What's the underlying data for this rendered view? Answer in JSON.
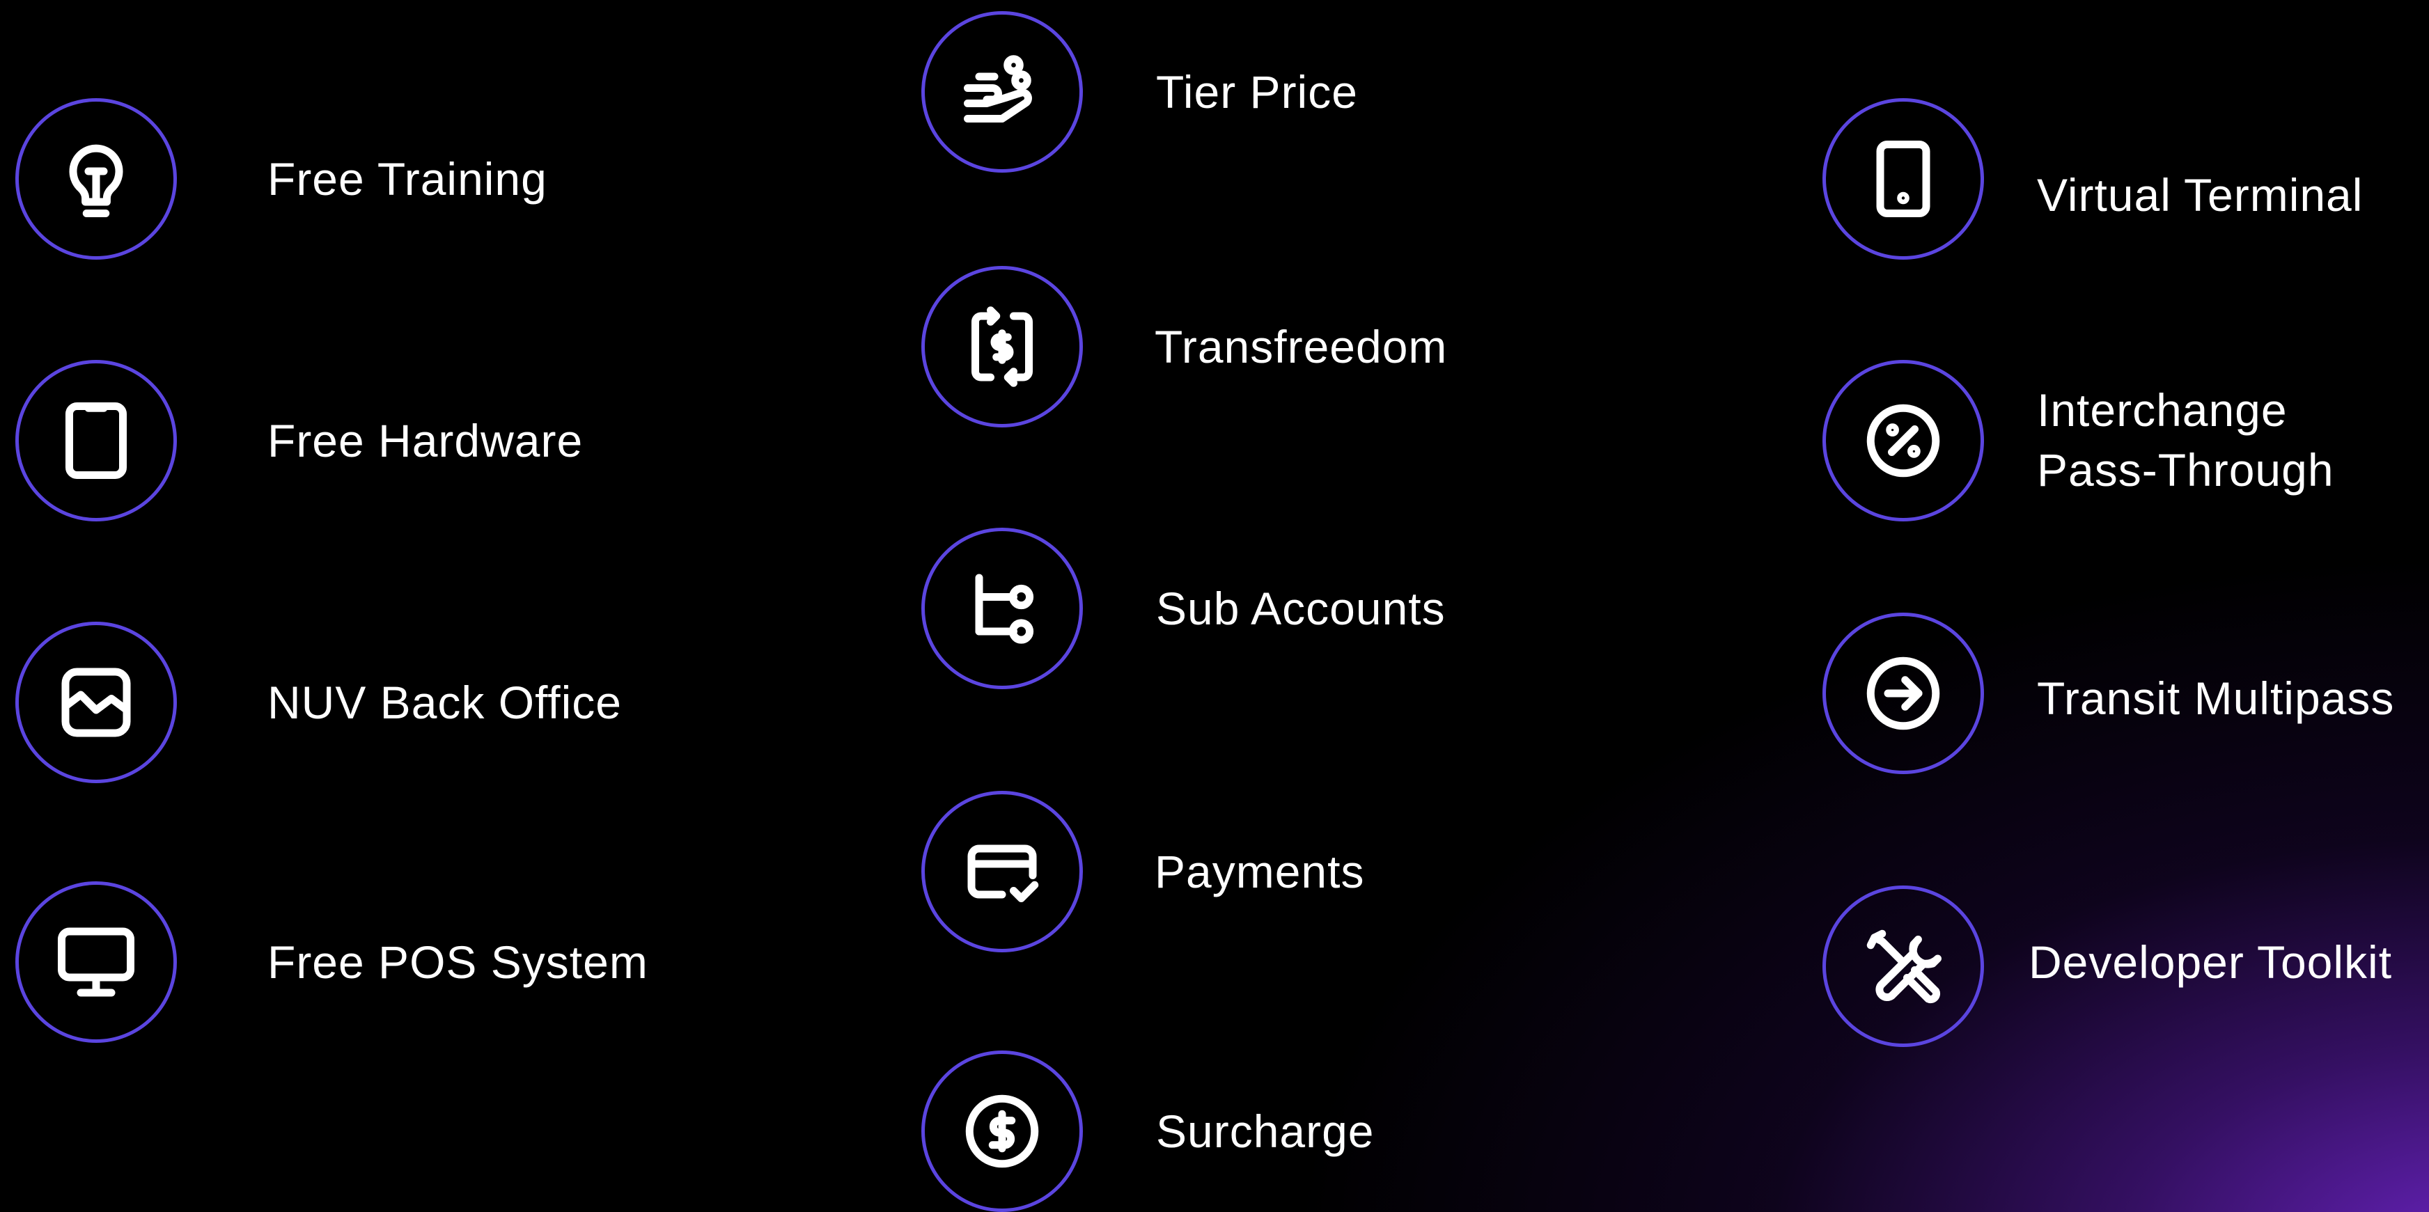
{
  "colors": {
    "ring": "#5b45e0",
    "glow": "#6c24c4",
    "background": "#000000",
    "text": "#ffffff"
  },
  "columns": [
    {
      "items": [
        {
          "label": "Free Training",
          "icon": "lightbulb-icon"
        },
        {
          "label": "Free Hardware",
          "icon": "tablet-icon"
        },
        {
          "label": "NUV Back Office",
          "icon": "image-frame-icon"
        },
        {
          "label": "Free POS System",
          "icon": "monitor-icon"
        }
      ]
    },
    {
      "items": [
        {
          "label": "Tier Price",
          "icon": "hand-coins-icon"
        },
        {
          "label": "Transfreedom",
          "icon": "dollar-transfer-icon"
        },
        {
          "label": "Sub Accounts",
          "icon": "branch-icon"
        },
        {
          "label": "Payments",
          "icon": "credit-card-check-icon"
        },
        {
          "label": "Surcharge",
          "icon": "dollar-circle-icon"
        }
      ]
    },
    {
      "items": [
        {
          "label": "Virtual Terminal",
          "icon": "phone-device-icon"
        },
        {
          "label_lines": [
            "Interchange",
            "Pass-Through"
          ],
          "icon": "percent-circle-icon"
        },
        {
          "label": "Transit Multipass",
          "icon": "arrow-right-circle-icon"
        },
        {
          "label": "Developer Toolkit",
          "icon": "tools-icon"
        }
      ]
    }
  ]
}
